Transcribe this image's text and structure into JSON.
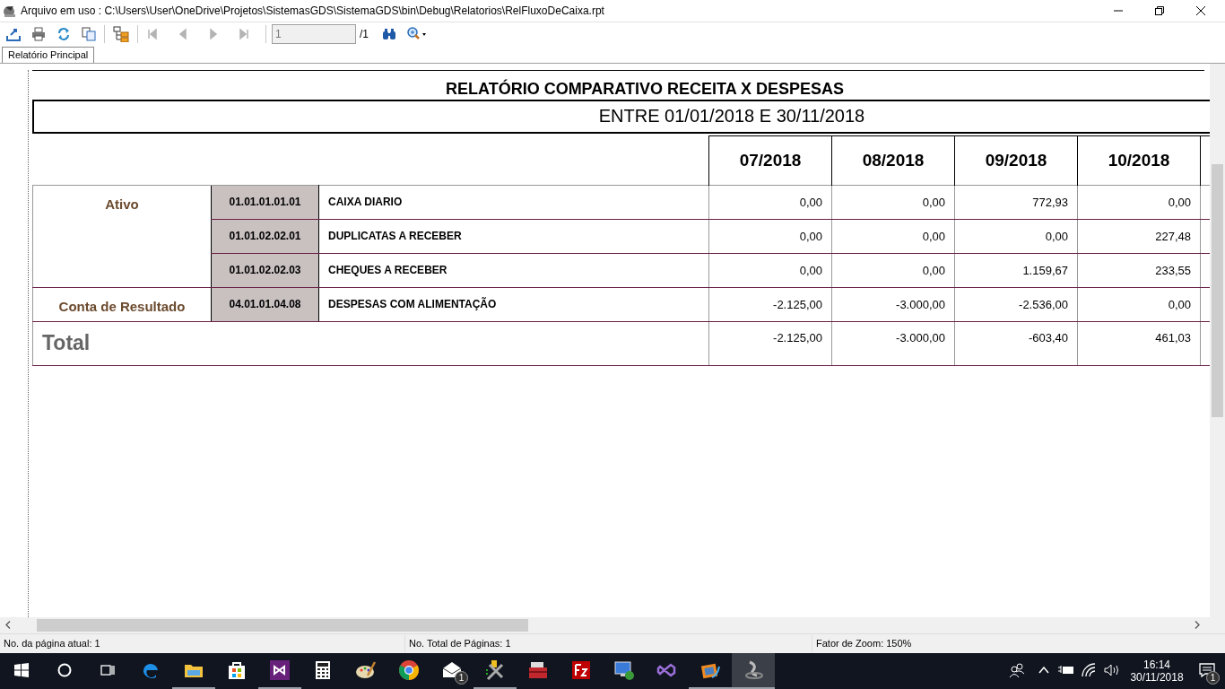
{
  "window": {
    "title": "Arquivo em uso : C:\\Users\\User\\OneDrive\\Projetos\\SistemasGDS\\SistemaGDS\\bin\\Debug\\Relatorios\\RelFluxoDeCaixa.rpt"
  },
  "toolbar": {
    "nav_buttons": [
      {
        "kind": "first",
        "disabled": true
      },
      {
        "kind": "prev",
        "disabled": true
      },
      {
        "kind": "next",
        "disabled": true
      },
      {
        "kind": "last",
        "disabled": true
      }
    ],
    "page_field": {
      "value": "1"
    },
    "page_total": "/1"
  },
  "tabs": [
    {
      "label": "Relatório Principal",
      "selected": true
    }
  ],
  "report": {
    "title": "RELATÓRIO COMPARATIVO RECEITA X DESPESAS",
    "subtitle": "ENTRE 01/01/2018 E 30/11/2018",
    "columns": [
      "07/2018",
      "08/2018",
      "09/2018",
      "10/2018"
    ],
    "groups": [
      {
        "name": "Ativo",
        "rows": [
          {
            "code": "01.01.01.01.01",
            "description": "CAIXA DIARIO",
            "values": [
              "0,00",
              "0,00",
              "772,93",
              "0,00"
            ]
          },
          {
            "code": "01.01.02.02.01",
            "description": "DUPLICATAS A RECEBER",
            "values": [
              "0,00",
              "0,00",
              "0,00",
              "227,48"
            ]
          },
          {
            "code": "01.01.02.02.03",
            "description": "CHEQUES A RECEBER",
            "values": [
              "0,00",
              "0,00",
              "1.159,67",
              "233,55"
            ]
          }
        ]
      },
      {
        "name": "Conta de Resultado",
        "rows": [
          {
            "code": "04.01.01.04.08",
            "description": "DESPESAS COM ALIMENTAÇÃO",
            "values": [
              "-2.125,00",
              "-3.000,00",
              "-2.536,00",
              "0,00"
            ]
          }
        ]
      }
    ],
    "total": {
      "label": "Total",
      "values": [
        "-2.125,00",
        "-3.000,00",
        "-603,40",
        "461,03"
      ]
    }
  },
  "status_bar": [
    "No. da página atual: 1",
    "No. Total de Páginas: 1",
    "Fator de Zoom: 150%"
  ],
  "taskbar": {
    "apps": [
      {
        "kind": "edge",
        "running": false
      },
      {
        "kind": "explorer",
        "running": true
      },
      {
        "kind": "store",
        "running": false
      },
      {
        "kind": "vs",
        "running": true
      },
      {
        "kind": "calculator",
        "running": false
      },
      {
        "kind": "paint",
        "running": false
      },
      {
        "kind": "chrome",
        "running": false
      },
      {
        "kind": "mail",
        "running": false,
        "badge": "1"
      },
      {
        "kind": "tools",
        "running": true
      },
      {
        "kind": "toolbox",
        "running": false
      },
      {
        "kind": "filezilla",
        "running": false
      },
      {
        "kind": "remote",
        "running": false
      },
      {
        "kind": "vs2",
        "running": false
      },
      {
        "kind": "video",
        "running": true
      },
      {
        "kind": "gds",
        "running": true,
        "selected": true
      }
    ],
    "time": "16:14",
    "date": "30/11/2018",
    "notification_badge": "1"
  }
}
